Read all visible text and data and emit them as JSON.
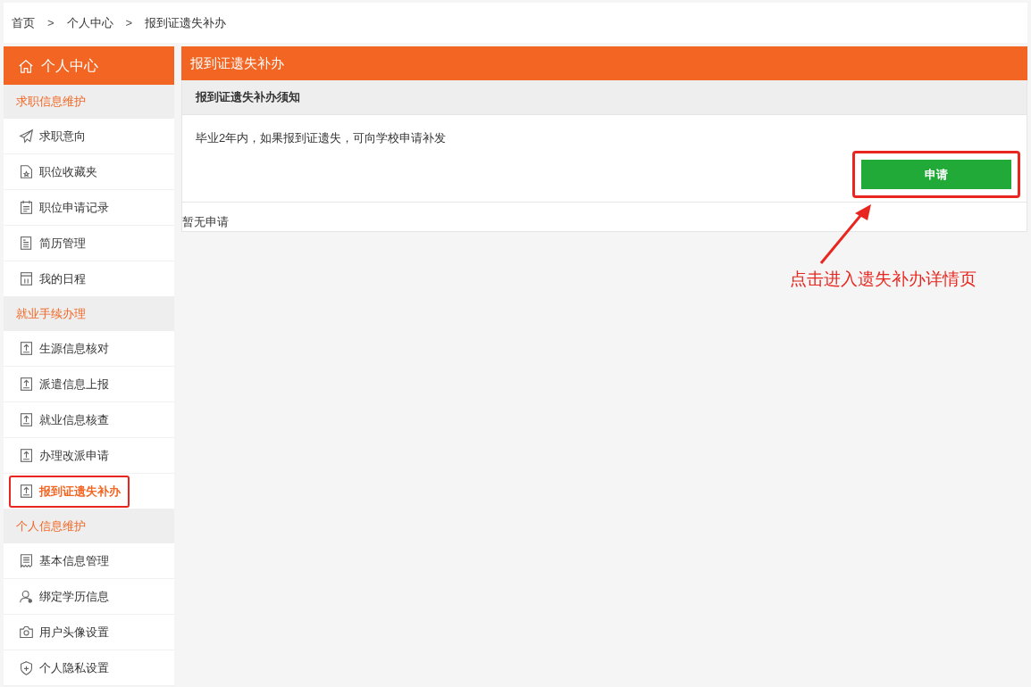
{
  "breadcrumb": [
    "首页",
    "个人中心",
    "报到证遗失补办"
  ],
  "breadcrumb_separator": ">",
  "sidebar": {
    "title": "个人中心",
    "items": [
      {
        "kind": "section",
        "label": "求职信息维护"
      },
      {
        "kind": "item",
        "label": "求职意向",
        "selected": false
      },
      {
        "kind": "item",
        "label": "职位收藏夹",
        "selected": false
      },
      {
        "kind": "item",
        "label": "职位申请记录",
        "selected": false
      },
      {
        "kind": "item",
        "label": "简历管理",
        "selected": false
      },
      {
        "kind": "item",
        "label": "我的日程",
        "selected": false
      },
      {
        "kind": "section",
        "label": "就业手续办理"
      },
      {
        "kind": "item",
        "label": "生源信息核对",
        "selected": false
      },
      {
        "kind": "item",
        "label": "派遣信息上报",
        "selected": false
      },
      {
        "kind": "item",
        "label": "就业信息核查",
        "selected": false
      },
      {
        "kind": "item",
        "label": "办理改派申请",
        "selected": false
      },
      {
        "kind": "item",
        "label": "报到证遗失补办",
        "selected": true
      },
      {
        "kind": "section",
        "label": "个人信息维护"
      },
      {
        "kind": "item",
        "label": "基本信息管理",
        "selected": false
      },
      {
        "kind": "item",
        "label": "绑定学历信息",
        "selected": false
      },
      {
        "kind": "item",
        "label": "用户头像设置",
        "selected": false
      },
      {
        "kind": "item",
        "label": "个人隐私设置",
        "selected": false
      }
    ]
  },
  "panel": {
    "title": "报到证遗失补办",
    "notice_title": "报到证遗失补办须知",
    "notice_text": "毕业2年内，如果报到证遗失，可向学校申请补发",
    "apply_button": "申请",
    "empty_text": "暂无申请"
  },
  "annotation": {
    "text": "点击进入遗失补办详情页"
  }
}
